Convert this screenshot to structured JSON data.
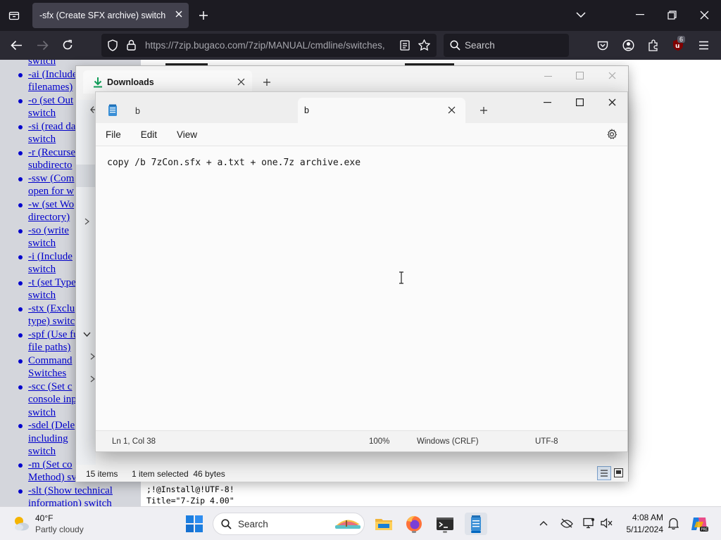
{
  "browser": {
    "tab_title": "-sfx (Create SFX archive) switch",
    "url": "https://7zip.bugaco.com/7zip/MANUAL/cmdline/switches,",
    "search_placeholder": "Search",
    "extensions_badge": "6"
  },
  "webpage": {
    "sidebar_links": [
      "switch",
      "-ai (Include",
      "filenames)",
      "-o (set Out",
      "switch",
      "-si (read da",
      "switch",
      "-r (Recurse",
      "subdirecto",
      "-ssw (Com",
      "open for w",
      "-w (set Wo",
      "directory)",
      "-so (write",
      "switch",
      "-i (Include",
      "switch",
      "-t (set Type",
      "switch",
      "-stx (Exclu",
      "type) switc",
      "-spf (Use fu",
      "file paths)",
      "Command",
      "Switches",
      "-scc (Set c",
      "console inp",
      "switch",
      "-sdel (Dele",
      "including",
      "switch",
      "-m (Set co",
      "Method) sv",
      "-slt (Show technical",
      "information) switch"
    ],
    "code_preview": [
      ";!@Install@!UTF-8!",
      "Title=\"7-Zip 4.00\""
    ]
  },
  "downloads": {
    "tab_title": "Downloads",
    "status_items": "15 items",
    "status_selected": "1 item selected  46 bytes"
  },
  "notepad": {
    "tabs": [
      "b",
      "b"
    ],
    "menu": [
      "File",
      "Edit",
      "View"
    ],
    "content": "copy /b 7zCon.sfx + a.txt + one.7z archive.exe",
    "status": {
      "position": "Ln 1, Col 38",
      "zoom": "100%",
      "line_ending": "Windows (CRLF)",
      "encoding": "UTF-8"
    }
  },
  "taskbar": {
    "weather_temp": "40°F",
    "weather_desc": "Partly cloudy",
    "search_label": "Search",
    "time": "4:08 AM",
    "date": "5/11/2024"
  },
  "colors": {
    "accent": "#0067c0",
    "link": "#0000cc",
    "firefox_bg": "#1c1b22"
  }
}
